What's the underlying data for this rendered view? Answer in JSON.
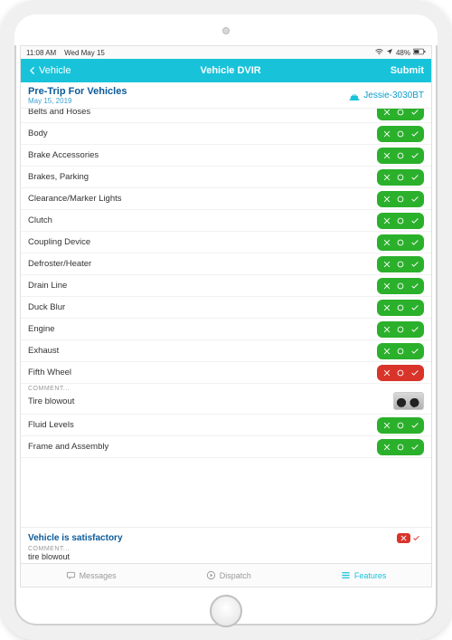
{
  "statusbar": {
    "time": "11:08 AM",
    "date": "Wed May 15",
    "battery": "48%"
  },
  "header": {
    "back": "Vehicle",
    "title": "Vehicle DVIR",
    "submit": "Submit"
  },
  "subheader": {
    "title": "Pre-Trip For Vehicles",
    "date": "May 15, 2019",
    "vehicle": "Jessie-3030BT"
  },
  "items": [
    {
      "label": "Belts and Hoses",
      "status": "green"
    },
    {
      "label": "Body",
      "status": "green"
    },
    {
      "label": "Brake Accessories",
      "status": "green"
    },
    {
      "label": "Brakes, Parking",
      "status": "green"
    },
    {
      "label": "Clearance/Marker Lights",
      "status": "green"
    },
    {
      "label": "Clutch",
      "status": "green"
    },
    {
      "label": "Coupling Device",
      "status": "green"
    },
    {
      "label": "Defroster/Heater",
      "status": "green"
    },
    {
      "label": "Drain Line",
      "status": "green"
    },
    {
      "label": "Duck Blur",
      "status": "green"
    },
    {
      "label": "Engine",
      "status": "green"
    },
    {
      "label": "Exhaust",
      "status": "green"
    },
    {
      "label": "Fifth Wheel",
      "status": "red"
    }
  ],
  "comment": {
    "label": "COMMENT...",
    "text": "Tire blowout"
  },
  "items_after": [
    {
      "label": "Fluid Levels",
      "status": "green"
    },
    {
      "label": "Frame and Assembly",
      "status": "green"
    }
  ],
  "footer": {
    "status": "Vehicle is satisfactory",
    "comment_label": "COMMENT...",
    "comment_text": "tire blowout"
  },
  "tabs": {
    "messages": "Messages",
    "dispatch": "Dispatch",
    "features": "Features"
  }
}
